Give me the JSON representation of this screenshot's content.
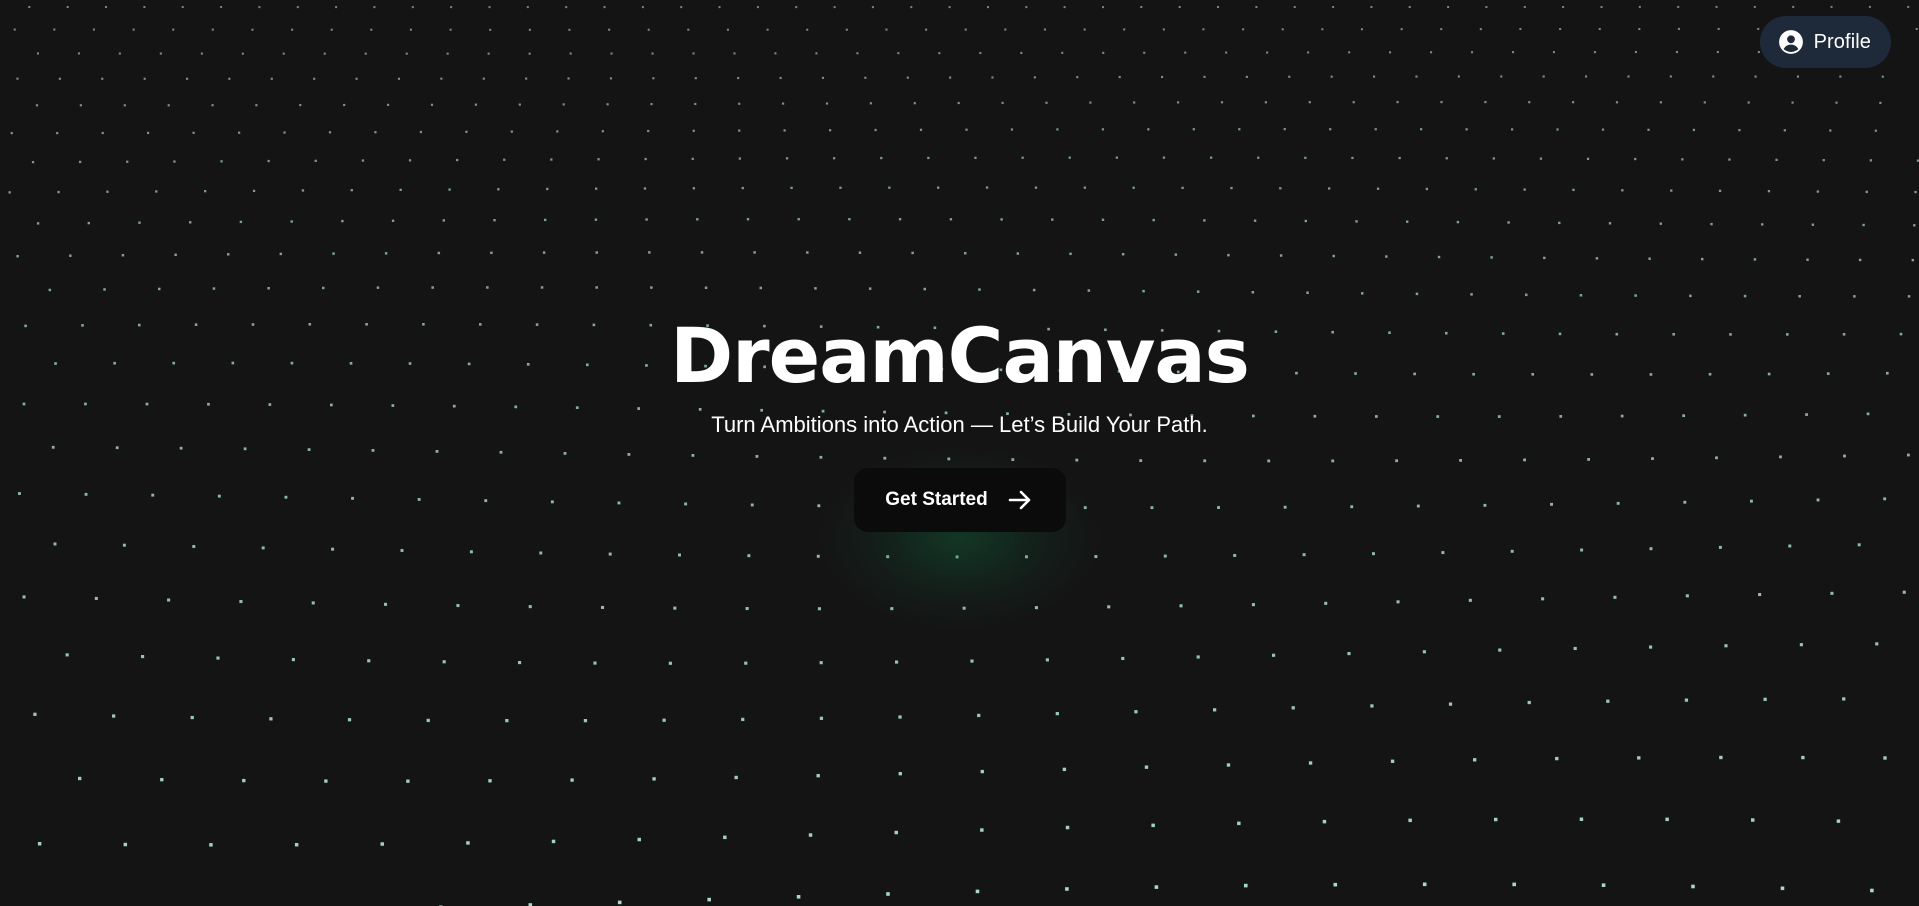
{
  "header": {
    "profile_label": "Profile",
    "profile_icon": "user-circle-icon"
  },
  "hero": {
    "title": "DreamCanvas",
    "subtitle": "Turn Ambitions into Action — Let’s Build Your Path.",
    "cta_label": "Get Started",
    "cta_icon": "arrow-right-icon"
  },
  "colors": {
    "background": "#141414",
    "dot": "#b8f0dc",
    "profile_bg": "#1e2a3a",
    "cta_bg": "#0b0b0b",
    "cta_glow": "#107846",
    "text": "#ffffff"
  }
}
